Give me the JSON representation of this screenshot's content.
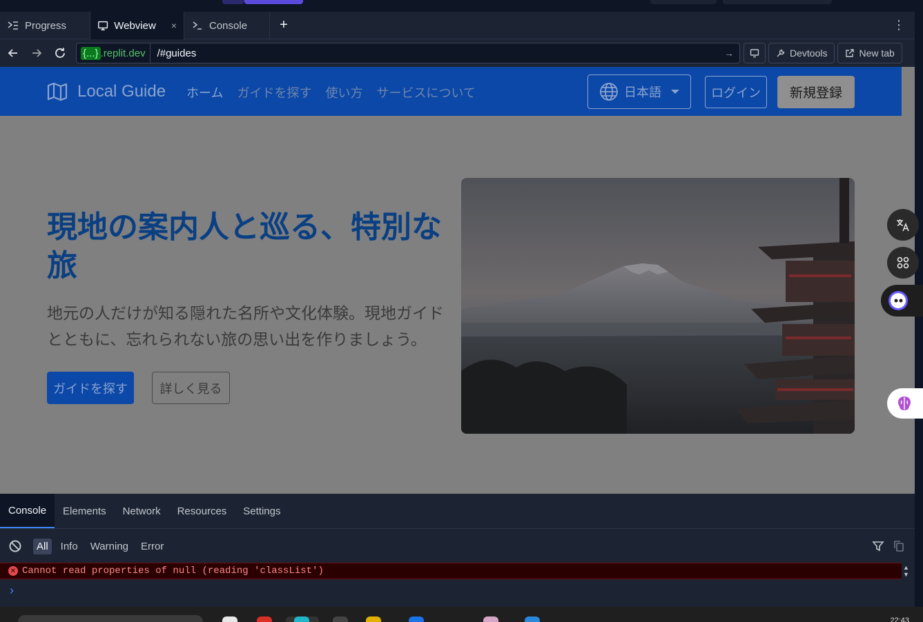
{
  "ide": {
    "tabs": [
      {
        "label": "Progress",
        "icon": "progress-icon"
      },
      {
        "label": "Webview",
        "icon": "monitor-icon",
        "close": "×"
      },
      {
        "label": "Console",
        "icon": "terminal-icon"
      }
    ],
    "add_tab": "+",
    "more": "⋮"
  },
  "urlbar": {
    "domain_badge": "{...}",
    "domain_host": ".replit.dev",
    "path": "/#guides",
    "go": "→",
    "devtools_label": "Devtools",
    "newtab_label": "New tab"
  },
  "site": {
    "brand": "Local Guide",
    "nav": [
      "ホーム",
      "ガイドを探す",
      "使い方",
      "サービスについて"
    ],
    "language": "日本語",
    "login": "ログイン",
    "signup": "新規登録",
    "hero_title": "現地の案内人と巡る、特別な旅",
    "hero_subtitle": "地元の人だけが知る隠れた名所や文化体験。現地ガイドとともに、忘れられない旅の思い出を作りましょう。",
    "cta_primary": "ガイドを探す",
    "cta_secondary": "詳しく見る"
  },
  "devtools": {
    "tabs": [
      "Console",
      "Elements",
      "Network",
      "Resources",
      "Settings"
    ],
    "levels": [
      "All",
      "Info",
      "Warning",
      "Error"
    ],
    "error_message": "Cannot read properties of null (reading 'classList')",
    "prompt": "›"
  },
  "taskbar": {
    "clock": "22:43"
  },
  "colors": {
    "site_nav": "#0c48a8",
    "hero_title": "#0a3f82",
    "ide_bg": "#1c2333",
    "error_bg": "#2b0000"
  }
}
